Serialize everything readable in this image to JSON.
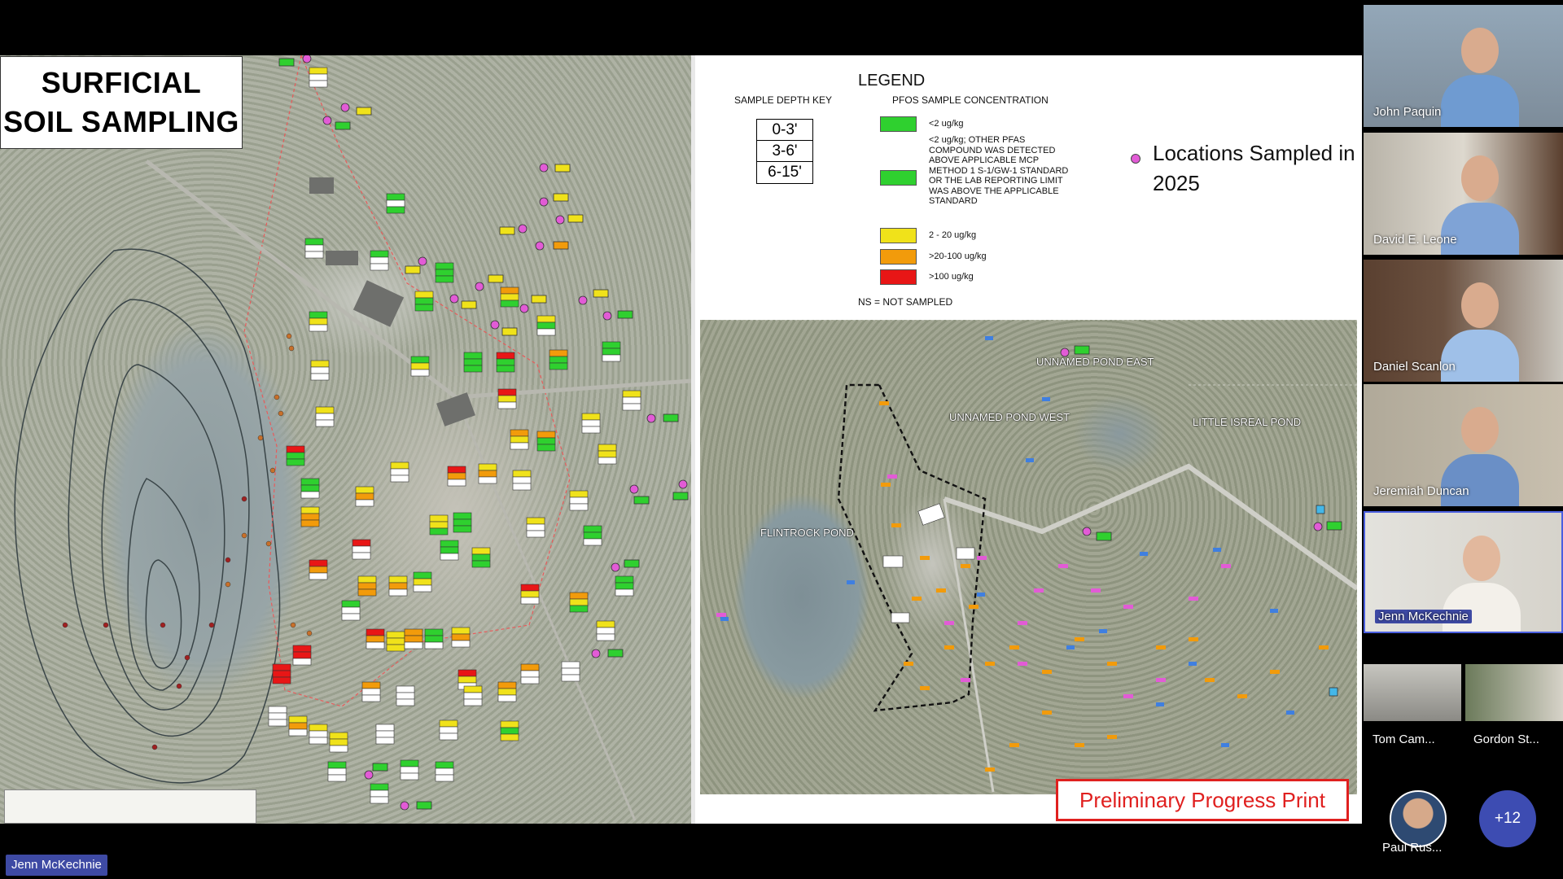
{
  "slide": {
    "title_line1": "SURFICIAL",
    "title_line2": "SOIL SAMPLING",
    "legend": {
      "title": "LEGEND",
      "depth_key_title": "SAMPLE DEPTH KEY",
      "depth_rows": [
        "0-3'",
        "3-6'",
        "6-15'"
      ],
      "pfos_title": "PFOS SAMPLE CONCENTRATION",
      "concentrations": [
        {
          "label": "<2 ug/kg",
          "color": "#2fd02f"
        },
        {
          "label": "<2 ug/kg; OTHER PFAS COMPOUND WAS DETECTED ABOVE APPLICABLE MCP METHOD 1 S-1/GW-1 STANDARD OR THE LAB REPORTING LIMIT WAS ABOVE THE APPLICABLE STANDARD",
          "color": "#2fd02f"
        },
        {
          "label": "2 - 20 ug/kg",
          "color": "#f0e21a"
        },
        {
          "label": ">20-100 ug/kg",
          "color": "#f29b0b"
        },
        {
          "label": ">100 ug/kg",
          "color": "#e81616"
        }
      ],
      "ns_note": "NS = NOT SAMPLED",
      "sampled_label": "Locations Sampled in 2025",
      "sampled_color": "#e25bd6"
    },
    "map_labels": {
      "pond_east": "UNNAMED POND EAST",
      "pond_west": "UNNAMED POND WEST",
      "little_isreal": "LITTLE ISREAL POND",
      "flintrock": "FLINTROCK POND"
    },
    "progress_print": "Preliminary Progress Print"
  },
  "participants": [
    {
      "name": "John Paquin",
      "shirt": "#6f9bd1"
    },
    {
      "name": "David E. Leone",
      "shirt": "#7fa3d6"
    },
    {
      "name": "Daniel Scanlon",
      "shirt": "#9fc0e8"
    },
    {
      "name": "Jeremiah Duncan",
      "shirt": "#6a8fc6"
    },
    {
      "name": "Jenn McKechnie",
      "shirt": "#f3f0ea"
    }
  ],
  "small_participants": [
    {
      "name": "Tom Cam..."
    },
    {
      "name": "Gordon St..."
    }
  ],
  "avatar_participant": {
    "name": "Paul Rus..."
  },
  "more_count": "+12",
  "active_speaker": "Jenn McKechnie"
}
